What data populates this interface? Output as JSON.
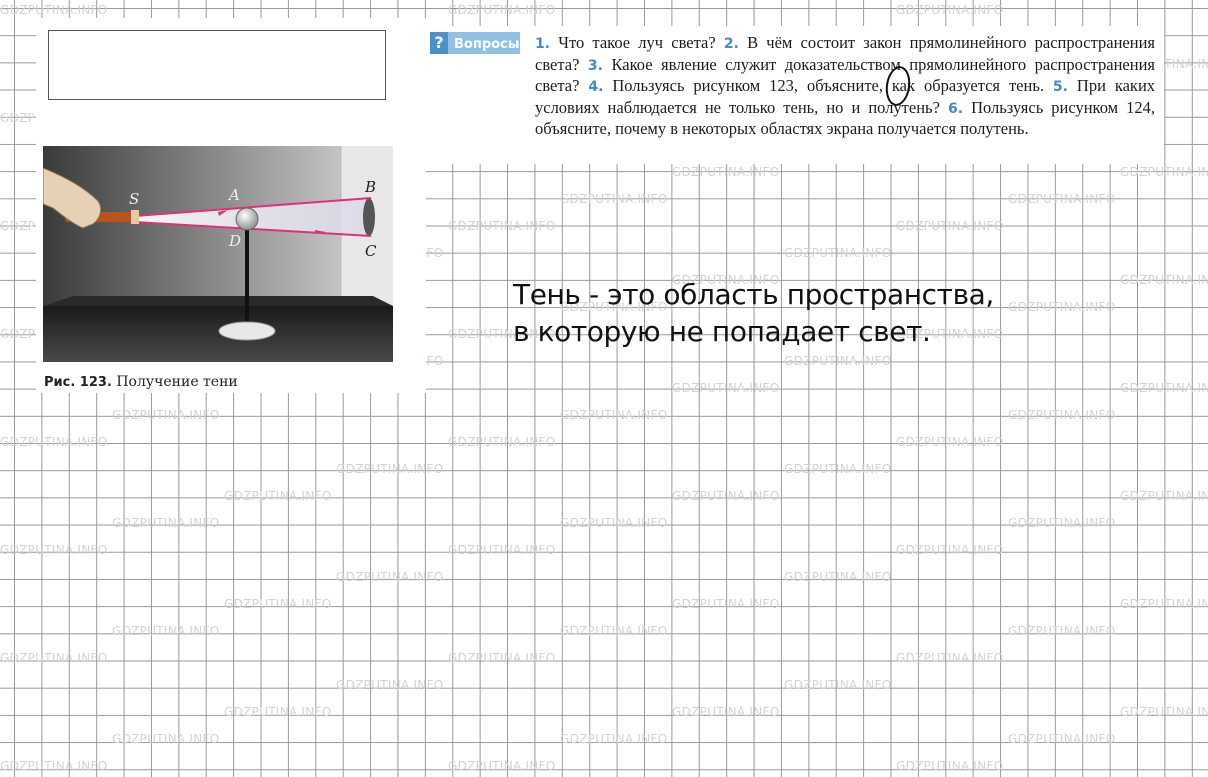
{
  "watermark": "GDZPUTINA.INFO",
  "figure": {
    "caption_number": "Рис. 123.",
    "caption_text": "Получение тени",
    "labels": {
      "s": "S",
      "a": "A",
      "b": "B",
      "c": "C",
      "d": "D"
    },
    "beam_color": "#e0307a"
  },
  "questions": {
    "badge_icon": "question-mark-icon",
    "badge_symbol": "?",
    "badge_label": "Вопросы",
    "items": [
      {
        "num": "1.",
        "text": "Что такое луч света?"
      },
      {
        "num": "2.",
        "text": "В чём состоит закон прямолинейного распространения света?"
      },
      {
        "num": "3.",
        "text": "Какое явление служит доказательством прямолинейного распространения света?"
      },
      {
        "num": "4.",
        "text": "Пользуясь рисунком 123, объясните, как образуется тень."
      },
      {
        "num": "5.",
        "text": "При каких условиях наблюдается не только тень, но и полутень?"
      },
      {
        "num": "6.",
        "text": "Пользуясь рисунком 124, объясните, почему в некоторых областях экрана получается полутень."
      }
    ]
  },
  "answer": {
    "line1": "Тень - это область пространства,",
    "line2": "в которую не попадает свет."
  }
}
